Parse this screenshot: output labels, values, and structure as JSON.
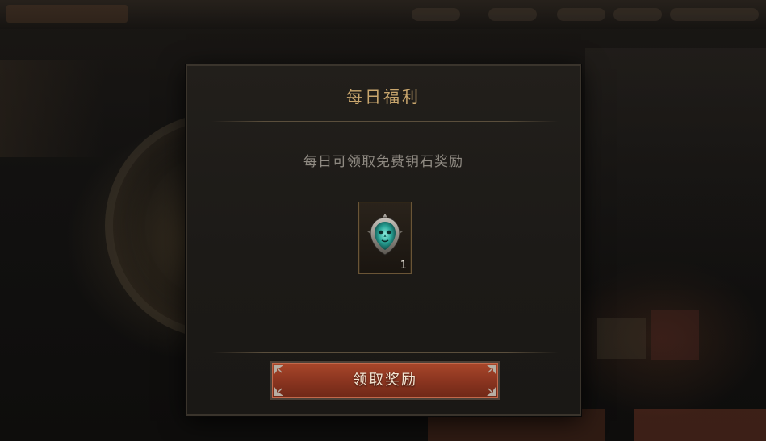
{
  "dialog": {
    "title": "每日福利",
    "description": "每日可领取免费钥石奖励",
    "reward": {
      "icon": "keystone-mask-icon",
      "count": "1"
    },
    "claim_button_label": "领取奖励"
  },
  "colors": {
    "title": "#c9a66d",
    "description": "#8f8a82",
    "button": "#8b3520"
  }
}
